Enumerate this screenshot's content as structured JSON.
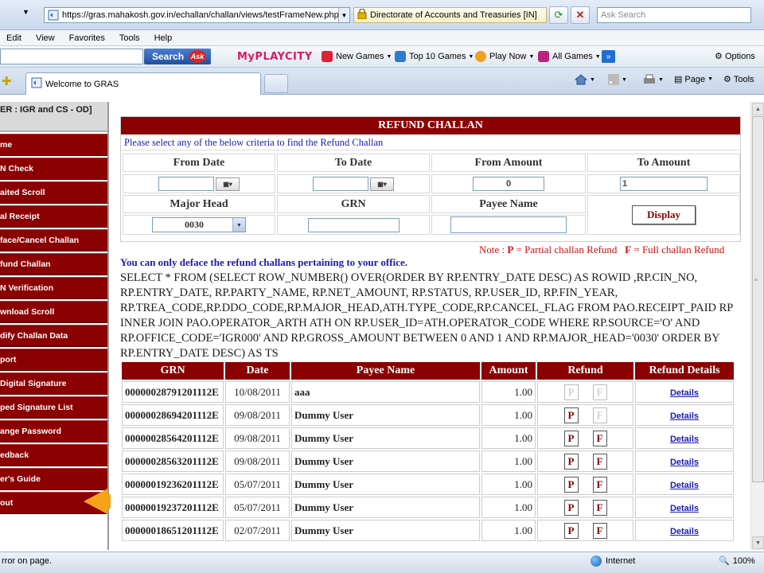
{
  "browser": {
    "url": "https://gras.mahakosh.gov.in/echallan/challan/views/testFrameNew.php",
    "certificate": "Directorate of Accounts and Treasuries [IN]",
    "search_placeholder": "Ask Search",
    "menu": [
      "Edit",
      "View",
      "Favorites",
      "Tools",
      "Help"
    ],
    "toolbar": {
      "search_label": "Search",
      "ask_label": "Ask",
      "logo": "MyPLAYCITY",
      "items": [
        "New Games",
        "Top 10 Games",
        "Play Now",
        "All Games"
      ],
      "more": "»",
      "options": "Options"
    },
    "tab_title": "Welcome to GRAS",
    "commands": {
      "page": "Page",
      "tools": "Tools"
    },
    "status": {
      "message": "rror on page.",
      "zone": "Internet",
      "zoom": "100%"
    }
  },
  "sidebar": {
    "user": "ER : IGR and CS - OD]",
    "items": [
      "me",
      "N Check",
      "aited Scroll",
      "al Receipt",
      "face/Cancel Challan",
      "fund Challan",
      "N Verification",
      "wnload Scroll",
      "dify Challan Data",
      "port",
      "Digital Signature",
      "ped Signature List",
      "ange Password",
      "edback",
      "er's Guide",
      "out"
    ]
  },
  "refund": {
    "title": "REFUND CHALLAN",
    "hint": "Please select any of the below criteria to find the Refund Challan",
    "labels": {
      "from_date": "From Date",
      "to_date": "To Date",
      "from_amount": "From Amount",
      "to_amount": "To Amount",
      "major_head": "Major Head",
      "grn": "GRN",
      "payee_name": "Payee Name"
    },
    "values": {
      "from_date": "",
      "to_date": "",
      "from_amount": "0",
      "to_amount": "1",
      "major_head": "0030",
      "grn": "",
      "payee_name": ""
    },
    "display_button": "Display",
    "note_prefix": "Note : ",
    "note_p": "P",
    "note_p_text": " = Partial challan Refund",
    "note_f": "F",
    "note_f_text": " = Full challan Refund",
    "warning": "You can only deface the refund challans pertaining to your office.",
    "sql": "SELECT * FROM (SELECT ROW_NUMBER() OVER(ORDER BY RP.ENTRY_DATE DESC) AS ROWID ,RP.CIN_NO, RP.ENTRY_DATE, RP.PARTY_NAME, RP.NET_AMOUNT, RP.STATUS, RP.USER_ID, RP.FIN_YEAR, RP.TREA_CODE,RP.DDO_CODE,RP.MAJOR_HEAD,ATH.TYPE_CODE,RP.CANCEL_FLAG FROM PAO.RECEIPT_PAID RP INNER JOIN PAO.OPERATOR_ARTH ATH ON RP.USER_ID=ATH.OPERATOR_CODE WHERE RP.SOURCE='O' AND RP.OFFICE_CODE='IGR000' AND RP.GROSS_AMOUNT BETWEEN 0 AND 1 AND RP.MAJOR_HEAD='0030' ORDER BY RP.ENTRY_DATE DESC) AS TS"
  },
  "results": {
    "headers": [
      "GRN",
      "Date",
      "Payee Name",
      "Amount",
      "Refund",
      "Refund Details"
    ],
    "rows": [
      {
        "grn": "00000028791201112E",
        "date": "10/08/2011",
        "payee": "aaa",
        "amount": "1.00",
        "p": "P",
        "f": "F",
        "p_enabled": false,
        "f_enabled": false,
        "details": "Details"
      },
      {
        "grn": "00000028694201112E",
        "date": "09/08/2011",
        "payee": "Dummy User",
        "amount": "1.00",
        "p": "P",
        "f": "F",
        "p_enabled": true,
        "f_enabled": false,
        "details": "Details"
      },
      {
        "grn": "00000028564201112E",
        "date": "09/08/2011",
        "payee": "Dummy User",
        "amount": "1.00",
        "p": "P",
        "f": "F",
        "p_enabled": true,
        "f_enabled": true,
        "details": "Details"
      },
      {
        "grn": "00000028563201112E",
        "date": "09/08/2011",
        "payee": "Dummy User",
        "amount": "1.00",
        "p": "P",
        "f": "F",
        "p_enabled": true,
        "f_enabled": true,
        "details": "Details"
      },
      {
        "grn": "00000019236201112E",
        "date": "05/07/2011",
        "payee": "Dummy User",
        "amount": "1.00",
        "p": "P",
        "f": "F",
        "p_enabled": true,
        "f_enabled": true,
        "details": "Details"
      },
      {
        "grn": "00000019237201112E",
        "date": "05/07/2011",
        "payee": "Dummy User",
        "amount": "1.00",
        "p": "P",
        "f": "F",
        "p_enabled": true,
        "f_enabled": true,
        "details": "Details"
      },
      {
        "grn": "00000018651201112E",
        "date": "02/07/2011",
        "payee": "Dummy User",
        "amount": "1.00",
        "p": "P",
        "f": "F",
        "p_enabled": true,
        "f_enabled": true,
        "details": "Details"
      }
    ]
  },
  "colors": {
    "maroon": "#8b0000",
    "link_blue": "#1a1ab0",
    "note_red": "#cc1010",
    "arrow_orange": "#f5a41a"
  }
}
